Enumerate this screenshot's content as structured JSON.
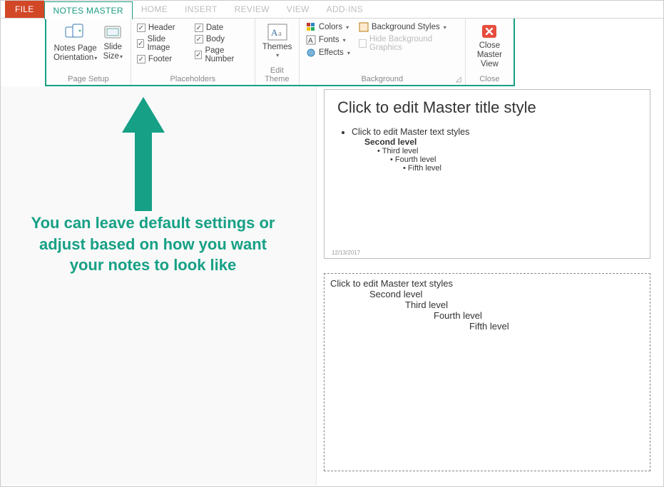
{
  "tabs": {
    "file": "FILE",
    "notes_master": "NOTES MASTER",
    "home": "HOME",
    "insert": "INSERT",
    "review": "REVIEW",
    "view": "VIEW",
    "addins": "ADD-INS"
  },
  "ribbon": {
    "page_setup": {
      "label": "Page Setup",
      "notes_orientation": "Notes Page\nOrientation",
      "slide_size": "Slide\nSize"
    },
    "placeholders": {
      "label": "Placeholders",
      "header": "Header",
      "slide_image": "Slide Image",
      "footer": "Footer",
      "date": "Date",
      "body": "Body",
      "page_number": "Page Number"
    },
    "edit_theme": {
      "label": "Edit Theme",
      "themes": "Themes"
    },
    "background": {
      "label": "Background",
      "colors": "Colors",
      "fonts": "Fonts",
      "effects": "Effects",
      "bg_styles": "Background Styles",
      "hide_bg": "Hide Background Graphics"
    },
    "close": {
      "label": "Close",
      "close_master": "Close\nMaster View"
    }
  },
  "annotation": "You can leave default settings or adjust based on how you want your notes to look like",
  "slide": {
    "title": "Click to edit Master title style",
    "levels": [
      "Click to edit Master text styles",
      "Second level",
      "Third level",
      "Fourth level",
      "Fifth level"
    ],
    "date": "12/13/2017"
  },
  "notes": {
    "levels": [
      "Click to edit Master text styles",
      "Second level",
      "Third level",
      "Fourth level",
      "Fifth level"
    ]
  }
}
